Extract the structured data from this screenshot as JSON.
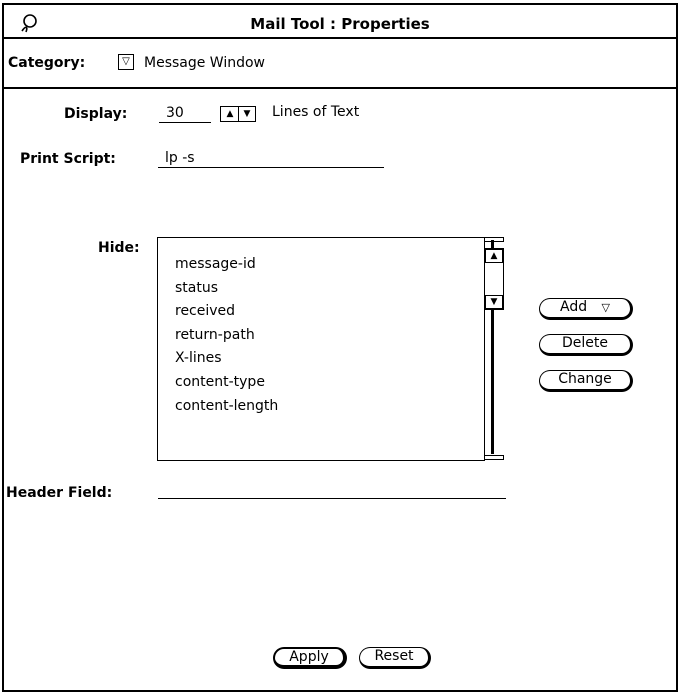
{
  "window": {
    "title": "Mail Tool : Properties"
  },
  "category": {
    "label": "Category:",
    "value": "Message Window"
  },
  "display": {
    "label": "Display:",
    "value": "30",
    "suffix": "Lines of Text"
  },
  "print_script": {
    "label": "Print Script:",
    "value": "lp -s"
  },
  "hide": {
    "label": "Hide:",
    "items": [
      "message-id",
      "status",
      "received",
      "return-path",
      "X-lines",
      "content-type",
      "content-length"
    ]
  },
  "list_buttons": {
    "add": "Add",
    "delete": "Delete",
    "change": "Change"
  },
  "header_field": {
    "label": "Header Field:",
    "value": ""
  },
  "footer": {
    "apply": "Apply",
    "reset": "Reset"
  }
}
